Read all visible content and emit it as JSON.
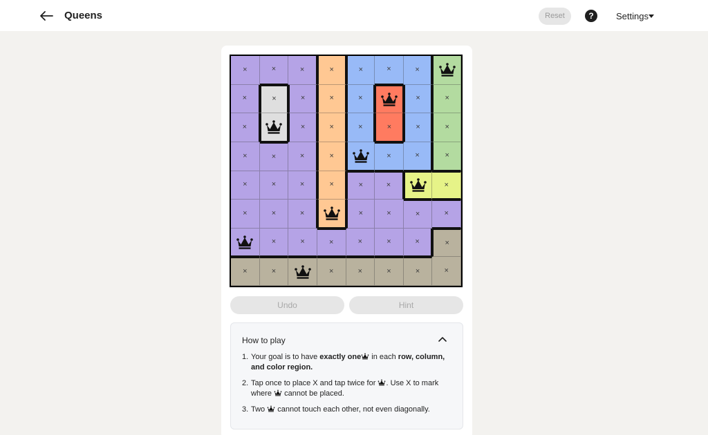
{
  "header": {
    "title": "Queens",
    "reset_label": "Reset",
    "help_label": "?",
    "settings_label": "Settings",
    "icons": [
      "back-arrow-icon",
      "help-icon",
      "caret-down-icon"
    ]
  },
  "colors": {
    "purple": "#b5a3e6",
    "orange": "#ffc893",
    "blue": "#98baf7",
    "green": "#b3dba0",
    "gray": "#dfdfdf",
    "red": "#ff7b60",
    "yellow": "#e6f388",
    "tan": "#b9b29e"
  },
  "board": {
    "size": 8,
    "regions": [
      [
        "purple",
        "purple",
        "purple",
        "orange",
        "blue",
        "blue",
        "blue",
        "green"
      ],
      [
        "purple",
        "gray",
        "purple",
        "orange",
        "blue",
        "red",
        "blue",
        "green"
      ],
      [
        "purple",
        "gray",
        "purple",
        "orange",
        "blue",
        "red",
        "blue",
        "green"
      ],
      [
        "purple",
        "purple",
        "purple",
        "orange",
        "blue",
        "blue",
        "blue",
        "green"
      ],
      [
        "purple",
        "purple",
        "purple",
        "orange",
        "purple",
        "purple",
        "yellow",
        "yellow"
      ],
      [
        "purple",
        "purple",
        "purple",
        "orange",
        "purple",
        "purple",
        "purple",
        "purple"
      ],
      [
        "purple",
        "purple",
        "purple",
        "purple",
        "purple",
        "purple",
        "purple",
        "tan"
      ],
      [
        "tan",
        "tan",
        "tan",
        "tan",
        "tan",
        "tan",
        "tan",
        "tan"
      ]
    ],
    "cells": [
      [
        "x",
        "x",
        "x",
        "x",
        "x",
        "x",
        "x",
        "Q"
      ],
      [
        "x",
        "x",
        "x",
        "x",
        "x",
        "Q",
        "x",
        "x"
      ],
      [
        "x",
        "Q",
        "x",
        "x",
        "x",
        "x",
        "x",
        "x"
      ],
      [
        "x",
        "x",
        "x",
        "x",
        "Q",
        "x",
        "x",
        "x"
      ],
      [
        "x",
        "x",
        "x",
        "x",
        "x",
        "x",
        "Q",
        "x"
      ],
      [
        "x",
        "x",
        "x",
        "Q",
        "x",
        "x",
        "x",
        "x"
      ],
      [
        "Q",
        "x",
        "x",
        "x",
        "x",
        "x",
        "x",
        "x"
      ],
      [
        "x",
        "x",
        "Q",
        "x",
        "x",
        "x",
        "x",
        "x"
      ]
    ],
    "x_glyph": "×",
    "queen_icon": "crown-icon"
  },
  "controls": {
    "undo_label": "Undo",
    "hint_label": "Hint"
  },
  "how_to_play": {
    "title": "How to play",
    "expanded": true,
    "rules": [
      {
        "num": "1.",
        "parts": [
          {
            "t": "Your goal is to have "
          },
          {
            "t": "exactly one",
            "b": true
          },
          {
            "icon": "crown-icon"
          },
          {
            "t": " in each "
          },
          {
            "t": "row, column, and color region.",
            "b": true
          }
        ]
      },
      {
        "num": "2.",
        "parts": [
          {
            "t": "Tap once to place X and tap twice for "
          },
          {
            "icon": "crown-icon"
          },
          {
            "t": ". Use X to mark where "
          },
          {
            "icon": "crown-icon"
          },
          {
            "t": " cannot be placed."
          }
        ]
      },
      {
        "num": "3.",
        "parts": [
          {
            "t": "Two "
          },
          {
            "icon": "crown-icon"
          },
          {
            "t": " cannot touch each other, not even diagonally."
          }
        ]
      }
    ]
  }
}
